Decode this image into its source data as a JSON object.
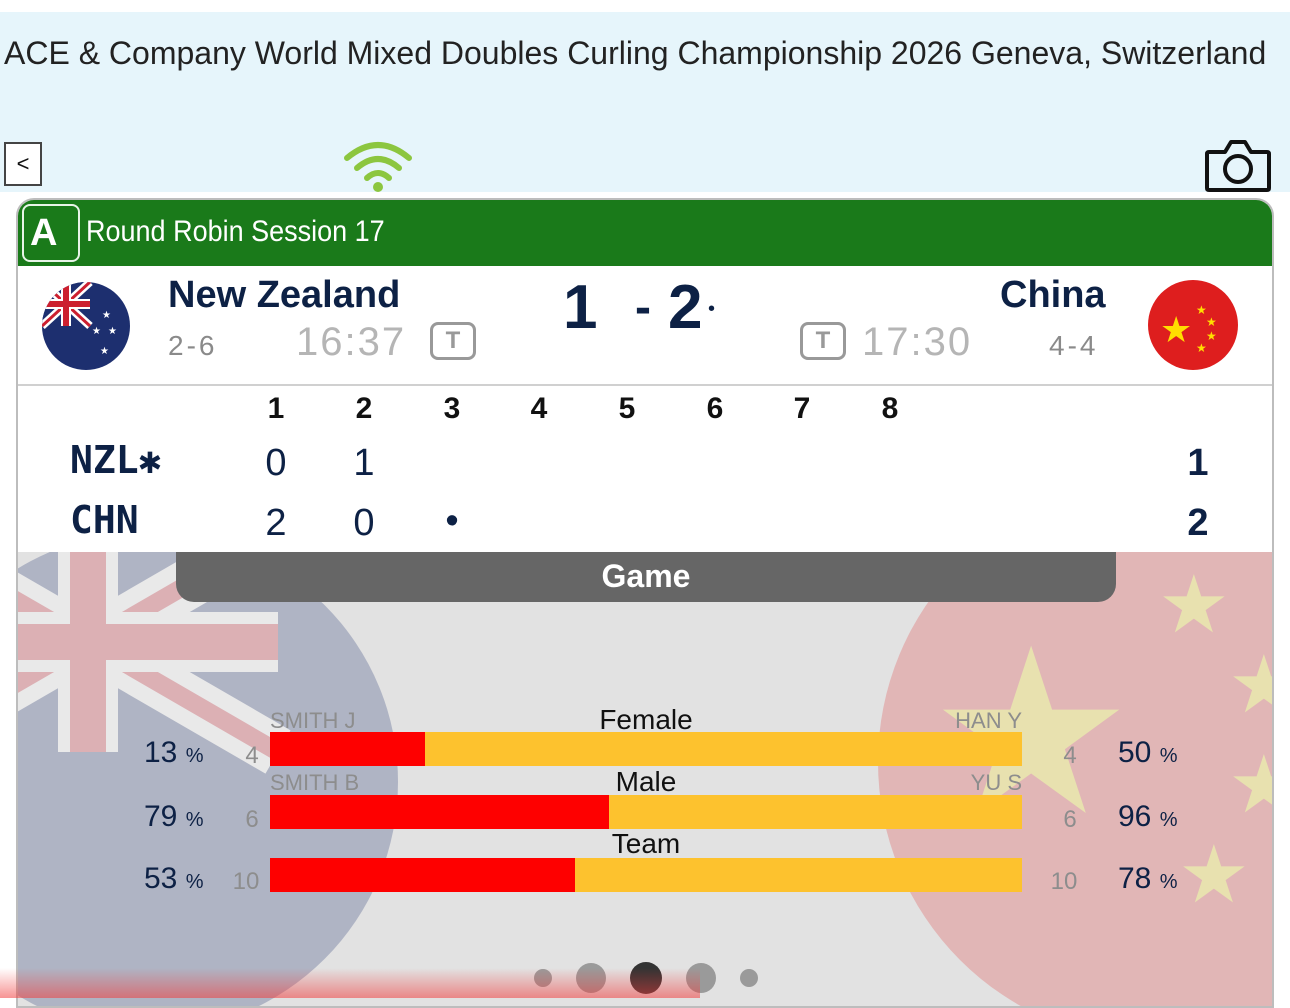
{
  "header": {
    "title": " ACE & Company World Mixed Doubles Curling Championship 2026 Geneva, Switzerland",
    "back_label": "<",
    "wifi_icon": "wifi-icon",
    "camera_icon": "camera-icon",
    "wifi_color": "#8cc63f"
  },
  "session": {
    "sheet": "A",
    "label": "Round Robin Session 17",
    "color": "#1a7a1a"
  },
  "teams": {
    "left": {
      "name": "New Zealand",
      "record": "2-6",
      "clock": "16:37",
      "timeout": "T",
      "score": "1",
      "flag_icon": "new-zealand-flag-icon"
    },
    "right": {
      "name": "China",
      "record": "4-4",
      "clock": "17:30",
      "timeout": "T",
      "score": "2",
      "flag_icon": "china-flag-icon"
    }
  },
  "score_separator": "-",
  "hammer_marker": "•",
  "scoreboard": {
    "ends": [
      "1",
      "2",
      "3",
      "4",
      "5",
      "6",
      "7",
      "8"
    ],
    "rows": [
      {
        "team": "NZL✱",
        "scores": [
          "0",
          "1",
          "",
          "",
          "",
          "",
          "",
          ""
        ],
        "total": "1"
      },
      {
        "team": "CHN",
        "scores": [
          "2",
          "0",
          "•",
          "",
          "",
          "",
          "",
          ""
        ],
        "total": "2"
      }
    ]
  },
  "stats": {
    "tab_label": "Game",
    "rows": [
      {
        "category": "Female",
        "left_player": "SMITH J",
        "right_player": "HAN Y",
        "left_count": "4",
        "right_count": "4",
        "left_pct": "13",
        "right_pct": "50",
        "left_share": 0.206
      },
      {
        "category": "Male",
        "left_player": "SMITH B",
        "right_player": "YU S",
        "left_count": "6",
        "right_count": "6",
        "left_pct": "79",
        "right_pct": "96",
        "left_share": 0.451
      },
      {
        "category": "Team",
        "left_player": "",
        "right_player": "",
        "left_count": "10",
        "right_count": "10",
        "left_pct": "53",
        "right_pct": "78",
        "left_share": 0.405
      }
    ],
    "pct_unit": "%",
    "colors": {
      "left": "#fe0000",
      "right": "#fdc22e"
    }
  },
  "pager": {
    "page_count": 5,
    "active_index": 2
  }
}
